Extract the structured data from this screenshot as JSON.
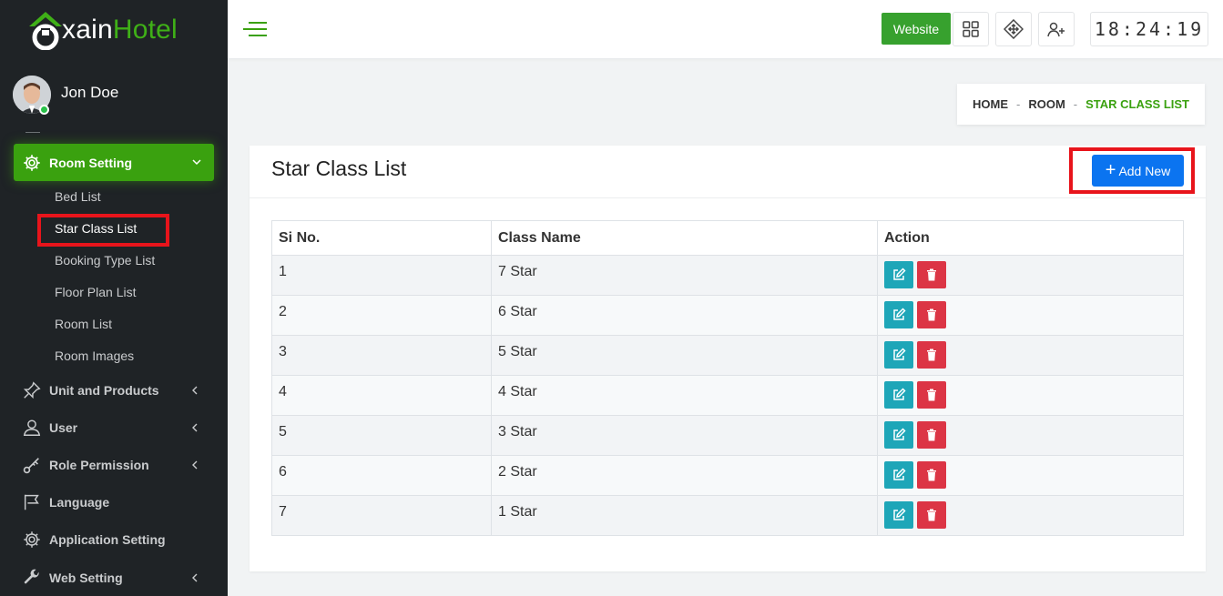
{
  "brand": {
    "name_part1": "xain",
    "name_part2": "Hotel",
    "colors": {
      "green": "#3fb017",
      "white": "#ffffff"
    }
  },
  "user": {
    "name": "Jon Doe",
    "status": "online"
  },
  "sidebar": {
    "active_section": {
      "label": "Room Setting",
      "icon": "gear-icon"
    },
    "submenu": [
      {
        "label": "Bed List"
      },
      {
        "label": "Star Class List",
        "active": true
      },
      {
        "label": "Booking Type List"
      },
      {
        "label": "Floor Plan List"
      },
      {
        "label": "Room List"
      },
      {
        "label": "Room Images"
      }
    ],
    "items": [
      {
        "label": "Unit and Products",
        "icon": "pin-icon",
        "has_children": true
      },
      {
        "label": "User",
        "icon": "user-icon",
        "has_children": true
      },
      {
        "label": "Role Permission",
        "icon": "key-icon",
        "has_children": true
      },
      {
        "label": "Language",
        "icon": "flag-icon",
        "has_children": false
      },
      {
        "label": "Application Setting",
        "icon": "gear-icon",
        "has_children": false
      },
      {
        "label": "Web Setting",
        "icon": "wrench-icon",
        "has_children": true
      }
    ]
  },
  "topbar": {
    "website_label": "Website",
    "icons": [
      "grid-icon",
      "move-icon",
      "add-user-icon"
    ],
    "clock": "18:24:19"
  },
  "breadcrumb": {
    "home": "HOME",
    "room": "ROOM",
    "current": "STAR CLASS LIST",
    "separator": "-"
  },
  "page": {
    "title": "Star Class List",
    "add_new_label": "Add New",
    "table": {
      "headers": [
        "Si No.",
        "Class Name",
        "Action"
      ],
      "rows": [
        {
          "si": "1",
          "name": "7 Star"
        },
        {
          "si": "2",
          "name": "6 Star"
        },
        {
          "si": "3",
          "name": "5 Star"
        },
        {
          "si": "4",
          "name": "4 Star"
        },
        {
          "si": "5",
          "name": "3 Star"
        },
        {
          "si": "6",
          "name": "2 Star"
        },
        {
          "si": "7",
          "name": "1 Star"
        }
      ]
    }
  }
}
